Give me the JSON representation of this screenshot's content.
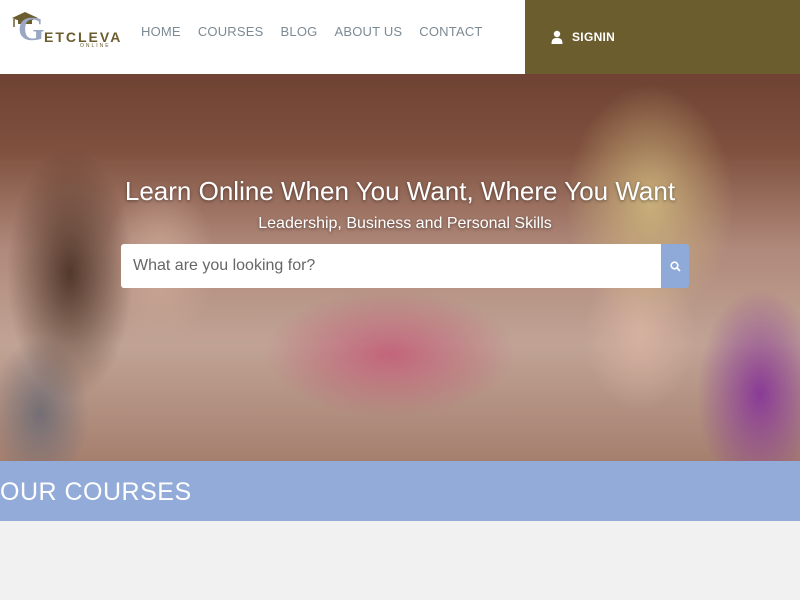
{
  "brand": {
    "logo_letter": "G",
    "logo_name": "ETCLEVA",
    "logo_sub": "ONLINE"
  },
  "nav": {
    "items": [
      {
        "label": "HOME"
      },
      {
        "label": "COURSES"
      },
      {
        "label": "BLOG"
      },
      {
        "label": "ABOUT US"
      },
      {
        "label": "CONTACT"
      }
    ]
  },
  "signin": {
    "label": "SIGNIN",
    "icon": "user-icon"
  },
  "hero": {
    "title": "Learn Online When You Want, Where You Want",
    "subtitle": "Leadership, Business and Personal Skills",
    "search_placeholder": "What are you looking for?",
    "search_icon": "search-icon"
  },
  "courses": {
    "title": "OUR COURSES"
  },
  "colors": {
    "header_bg": "#ffffff",
    "signin_bg": "#6b5d2e",
    "nav_text": "#7c8a94",
    "accent_blue": "#92abd9",
    "page_bg": "#f2f1f1"
  }
}
